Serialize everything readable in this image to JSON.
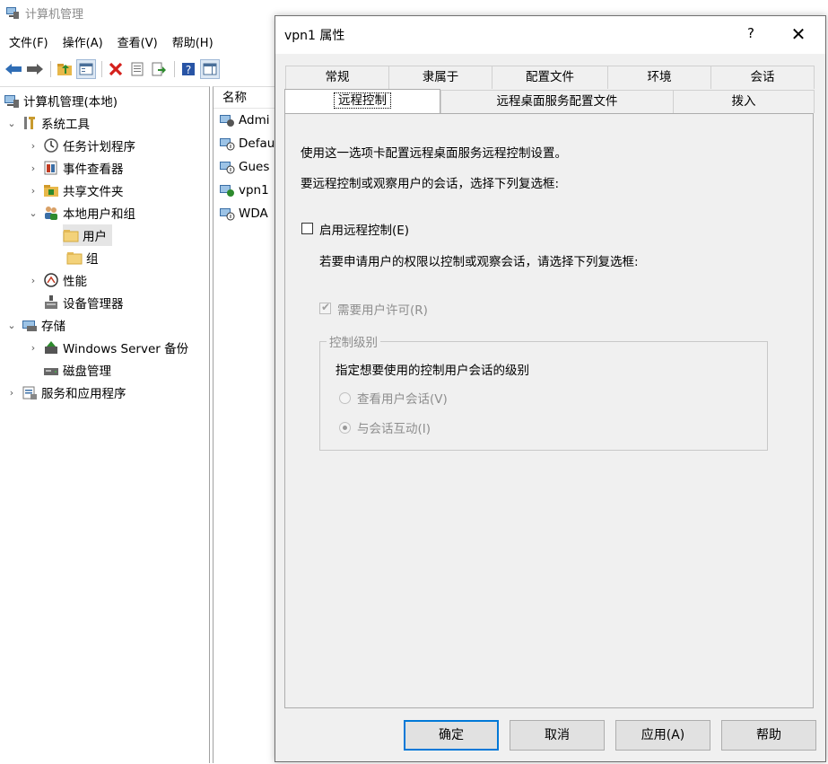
{
  "window": {
    "title": "计算机管理"
  },
  "menu": [
    "文件(F)",
    "操作(A)",
    "查看(V)",
    "帮助(H)"
  ],
  "tree": {
    "root": "计算机管理(本地)",
    "system_tools": "系统工具",
    "task_scheduler": "任务计划程序",
    "event_viewer": "事件查看器",
    "shared_folders": "共享文件夹",
    "local_users_groups": "本地用户和组",
    "users": "用户",
    "groups": "组",
    "performance": "性能",
    "device_manager": "设备管理器",
    "storage": "存储",
    "windows_server_backup": "Windows Server 备份",
    "disk_management": "磁盘管理",
    "services_apps": "服务和应用程序"
  },
  "list": {
    "header": "名称",
    "rows": [
      "Admi",
      "Defau",
      "Gues",
      "vpn1",
      "WDA"
    ]
  },
  "dialog": {
    "title": "vpn1 属性",
    "help": "?",
    "close": "✕",
    "tabs_row1": [
      "常规",
      "隶属于",
      "配置文件",
      "环境",
      "会话"
    ],
    "tabs_row2": [
      "远程控制",
      "远程桌面服务配置文件",
      "拨入"
    ],
    "intro1": "使用这一选项卡配置远程桌面服务远程控制设置。",
    "intro2": "要远程控制或观察用户的会话，选择下列复选框:",
    "enable_remote_control": {
      "label": "启用远程控制(E)",
      "checked": false
    },
    "permission_note": "若要申请用户的权限以控制或观察会话，请选择下列复选框:",
    "require_permission": {
      "label": "需要用户许可(R)",
      "checked": true,
      "enabled": false
    },
    "control_level": {
      "legend": "控制级别",
      "description": "指定想要使用的控制用户会话的级别",
      "view_session": {
        "label": "查看用户会话(V)",
        "selected": false
      },
      "interact_session": {
        "label": "与会话互动(I)",
        "selected": true
      }
    },
    "buttons": {
      "ok": "确定",
      "cancel": "取消",
      "apply": "应用(A)",
      "help": "帮助"
    }
  },
  "colors": {
    "accent": "#0078d7",
    "dialog_bg": "#f0f0f0",
    "disabled_text": "#8e8e8e"
  }
}
